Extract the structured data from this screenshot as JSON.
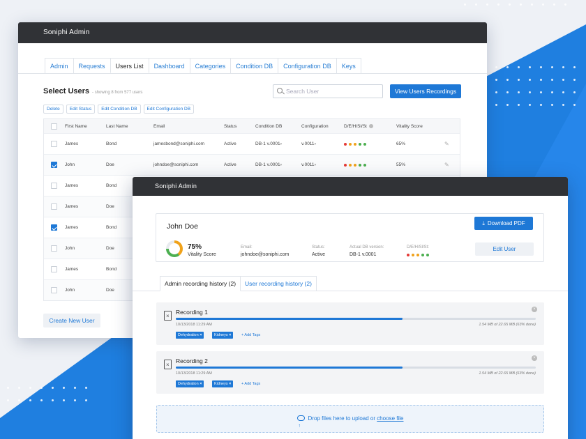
{
  "users_window": {
    "title": "Soniphi Admin",
    "tabs": [
      "Admin",
      "Requests",
      "Users List",
      "Dashboard",
      "Categories",
      "Condition DB",
      "Configuration DB",
      "Keys"
    ],
    "active_tab": "Users List",
    "heading": "Select Users",
    "subheading": "- showing 8 from 577 users",
    "search_placeholder": "Search User",
    "view_recordings_label": "View Users Recordings",
    "action_buttons": [
      "Delete",
      "Edit Status",
      "Edit Condition DB",
      "Edit Configuration DB"
    ],
    "columns": [
      "First Name",
      "Last Name",
      "Email",
      "Status",
      "Condition DB",
      "Configuration",
      "D/E/H/Sl/St",
      "Vitality Score"
    ],
    "rows": [
      {
        "first": "James",
        "last": "Bond",
        "email": "jamesbond@soniphi.com",
        "status": "Active",
        "cond": "DB-1 v.0001",
        "config": "v.0011",
        "score": "65%",
        "checked": false
      },
      {
        "first": "John",
        "last": "Doe",
        "email": "johndoe@soniphi.com",
        "status": "Active",
        "cond": "DB-1 v.0001",
        "config": "v.0011",
        "score": "55%",
        "checked": true
      },
      {
        "first": "James",
        "last": "Bond",
        "checked": false
      },
      {
        "first": "James",
        "last": "Doe",
        "checked": false
      },
      {
        "first": "James",
        "last": "Bond",
        "checked": true
      },
      {
        "first": "John",
        "last": "Doe",
        "checked": false
      },
      {
        "first": "James",
        "last": "Bond",
        "checked": false
      },
      {
        "first": "John",
        "last": "Doe",
        "checked": false
      }
    ],
    "status_dot_colors": [
      "#e53935",
      "#f0a21a",
      "#f0a21a",
      "#4caf50",
      "#4caf50"
    ],
    "create_label": "Create New User"
  },
  "detail_window": {
    "title": "Soniphi Admin",
    "user_name": "John Doe",
    "download_label": "Download PDF",
    "vitality_value": "75%",
    "vitality_label": "Vitality Score",
    "vitality_fraction": 0.75,
    "email_label": "Email:",
    "email": "johndoe@soniphi.com",
    "status_label": "Status:",
    "status": "Active",
    "db_label": "Actual DB version:",
    "db_version": "DB-1 v.0001",
    "dehs_label": "D/E/H/Sl/St:",
    "edit_label": "Edit User",
    "tabs": [
      "Admin recording history (2)",
      "User recording history (2)"
    ],
    "recordings": [
      {
        "title": "Recording 1",
        "date": "10/13/2018 11:29 AM",
        "size": "1.54 MB of 22.65 MB (63% done)",
        "progress": 0.63,
        "tags": [
          "Dehydration",
          "Kidneys"
        ],
        "add_tags": "+ Add Tags"
      },
      {
        "title": "Recording 2",
        "date": "10/13/2018 11:29 AM",
        "size": "1.54 MB of 22.65 MB (63% done)",
        "progress": 0.63,
        "tags": [
          "Dehydration",
          "Kidneys"
        ],
        "add_tags": "+ Add Tags"
      }
    ],
    "drop_text": "Drop files here to upload or",
    "drop_link": "choose file"
  },
  "colors": {
    "accent": "#1e78d6",
    "titlebar": "#303236",
    "background_blue": "#1f7fe0"
  }
}
